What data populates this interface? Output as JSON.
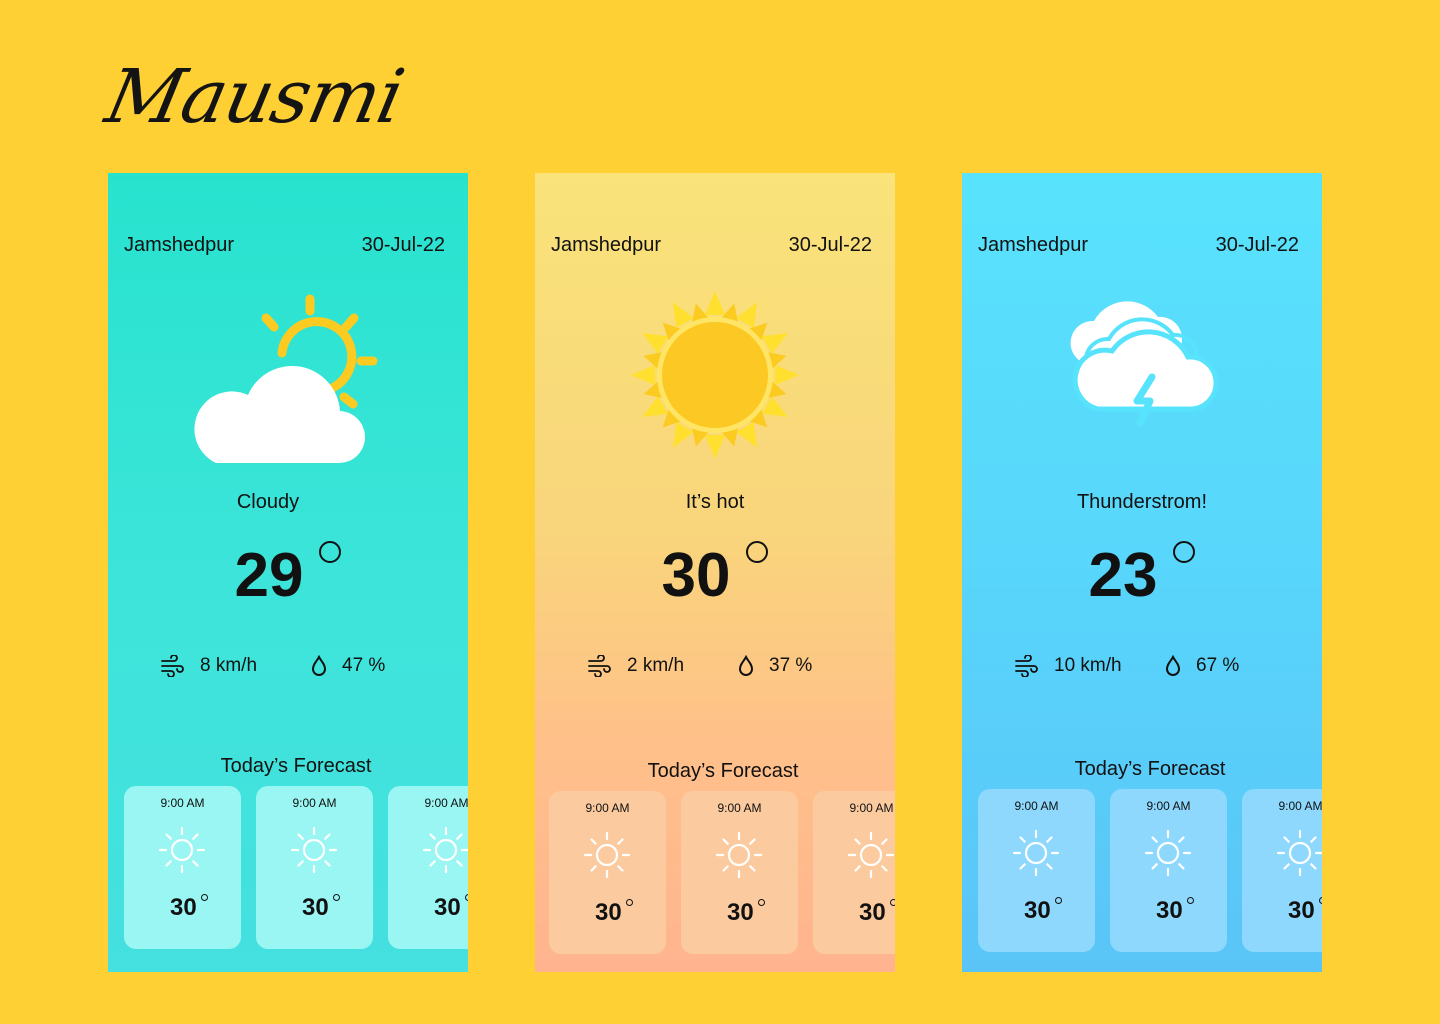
{
  "app": {
    "title": "Mausmi"
  },
  "cards": [
    {
      "theme": "cloudy",
      "city": "Jamshedpur",
      "date": "30-Jul-22",
      "weather_icon": "partly-cloudy-icon",
      "condition": "Cloudy",
      "temperature": "29",
      "wind": "8 km/h",
      "humidity": "47 %",
      "forecast_title": "Today’s Forecast",
      "forecast": [
        {
          "time": "9:00 AM",
          "icon": "sun-icon",
          "temp": "30"
        },
        {
          "time": "9:00 AM",
          "icon": "sun-icon",
          "temp": "30"
        },
        {
          "time": "9:00 AM",
          "icon": "sun-icon",
          "temp": "30"
        }
      ]
    },
    {
      "theme": "hot",
      "city": "Jamshedpur",
      "date": "30-Jul-22",
      "weather_icon": "sun-icon",
      "condition": "It’s hot",
      "temperature": "30",
      "wind": "2 km/h",
      "humidity": "37 %",
      "forecast_title": "Today’s Forecast",
      "forecast": [
        {
          "time": "9:00 AM",
          "icon": "sun-icon",
          "temp": "30"
        },
        {
          "time": "9:00 AM",
          "icon": "sun-icon",
          "temp": "30"
        },
        {
          "time": "9:00 AM",
          "icon": "sun-icon",
          "temp": "30"
        }
      ]
    },
    {
      "theme": "storm",
      "city": "Jamshedpur",
      "date": "30-Jul-22",
      "weather_icon": "thunderstorm-icon",
      "condition": "Thunderstrom!",
      "temperature": "23",
      "wind": "10 km/h",
      "humidity": "67 %",
      "forecast_title": "Today’s Forecast",
      "forecast": [
        {
          "time": "9:00 AM",
          "icon": "sun-icon",
          "temp": "30"
        },
        {
          "time": "9:00 AM",
          "icon": "sun-icon",
          "temp": "30"
        },
        {
          "time": "9:00 AM",
          "icon": "sun-icon",
          "temp": "30"
        }
      ]
    }
  ],
  "colors": {
    "background": "#FFD033",
    "card_cloudy": "#27E3CE",
    "card_hot": "#F9E37A",
    "card_storm": "#58E3FC",
    "sun": "#FCCB21"
  }
}
